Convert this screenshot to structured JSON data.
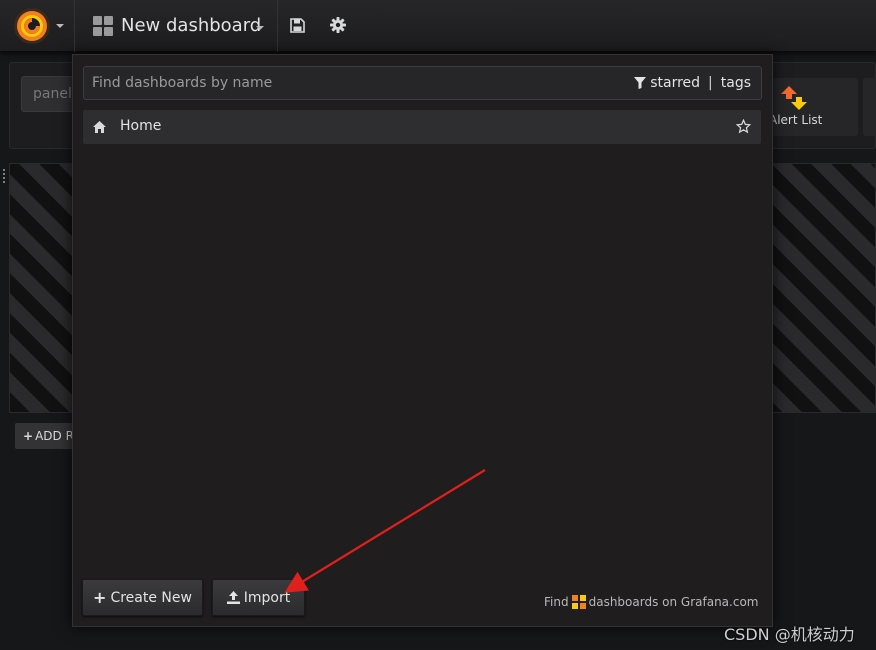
{
  "navbar": {
    "dashboard_title": "New dashboard"
  },
  "background": {
    "panel_search_placeholder": "panel",
    "alert_tile_label": "Alert List",
    "add_row_label": "ADD R"
  },
  "search": {
    "placeholder": "Find dashboards by name",
    "filter_starred": "starred",
    "filter_separator": "|",
    "filter_tags": "tags",
    "results": [
      {
        "label": "Home",
        "icon": "home-icon",
        "starred": false
      }
    ]
  },
  "buttons": {
    "create_new": "Create New",
    "import": "Import"
  },
  "footer": {
    "find_prefix": "Find",
    "find_suffix": "dashboards on Grafana.com"
  },
  "watermark": "CSDN @机核动力",
  "colors": {
    "grafana_orange": "#f3801f",
    "grafana_yellow": "#fbca0a",
    "annotation_arrow": "#e0201c"
  }
}
